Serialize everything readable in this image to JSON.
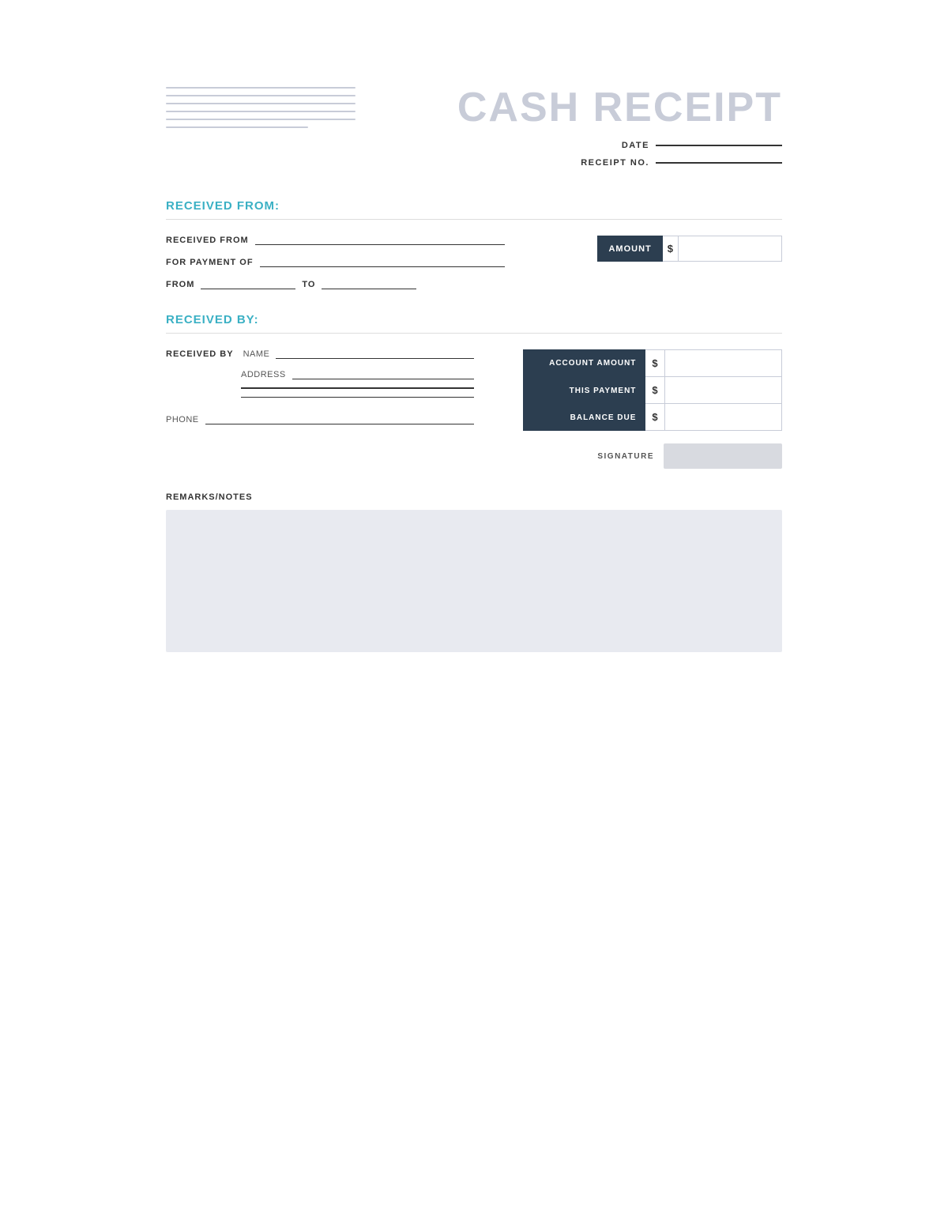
{
  "header": {
    "title": "CASH RECEIPT",
    "date_label": "DATE",
    "receipt_no_label": "RECEIPT NO."
  },
  "received_from_section": {
    "title": "RECEIVED FROM:",
    "received_from_label": "RECEIVED FROM",
    "for_payment_of_label": "FOR PAYMENT OF",
    "from_label": "FROM",
    "to_label": "TO",
    "amount_label": "AMOUNT",
    "currency_symbol": "$"
  },
  "received_by_section": {
    "title": "RECEIVED BY:",
    "received_by_label": "RECEIVED BY",
    "name_label": "NAME",
    "address_label": "ADDRESS",
    "phone_label": "PHONE",
    "account_amount_label": "ACCOUNT AMOUNT",
    "this_payment_label": "THIS PAYMENT",
    "balance_due_label": "BALANCE DUE",
    "currency_symbol": "$",
    "signature_label": "SIGNATURE"
  },
  "remarks_section": {
    "label": "REMARKS/NOTES"
  }
}
